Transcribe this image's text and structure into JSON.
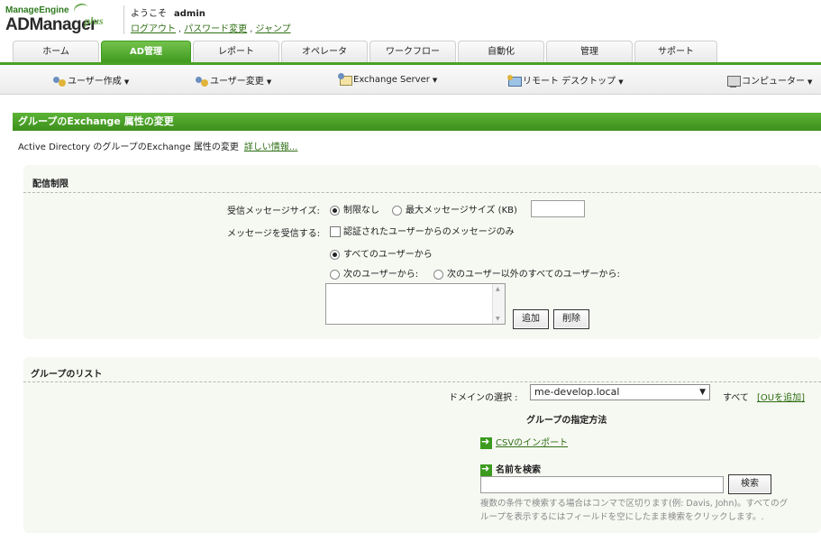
{
  "header": {
    "logo_top": "ManageEngine",
    "logo_main": "ADManager",
    "logo_plus": "plus",
    "welcome": "ようこそ",
    "user": "admin",
    "links": [
      "ログアウト",
      "パスワード変更",
      "ジャンプ"
    ],
    "sep": ","
  },
  "tabs": [
    "ホーム",
    "AD管理",
    "レポート",
    "オペレータ",
    "ワークフロー",
    "自動化",
    "管理",
    "サポート"
  ],
  "subnav": [
    "ユーザー作成",
    "ユーザー変更",
    "Exchange Server",
    "リモート デスクトップ",
    "コンピューター"
  ],
  "caret": "▼",
  "section": {
    "title": "グループのExchange 属性の変更",
    "description": "Active Directory のグループのExchange 属性の変更",
    "more_link": "詳しい情報..."
  },
  "delivery": {
    "title": "配信制限",
    "msg_size_label": "受信メッセージサイズ:",
    "opt_unlimited": "制限なし",
    "opt_max": "最大メッセージサイズ (KB)",
    "max_size_value": "",
    "accept_label": "メッセージを受信する:",
    "auth_only": "認証されたユーザーからのメッセージのみ",
    "from_all": "すべてのユーザーから",
    "from_following": "次のユーザーから:",
    "from_all_except": "次のユーザー以外のすべてのユーザーから:",
    "add_button": "追加",
    "delete_button": "削除"
  },
  "groups": {
    "title": "グループのリスト",
    "domain_label": "ドメインの選択 :",
    "domain_value": "me-develop.local",
    "all_label": "すべて",
    "add_ou": "[OUを追加]",
    "method_title": "グループの指定方法",
    "csv_import": "CSVのインポート",
    "search_by_name": "名前を検索",
    "search_value": "",
    "search_button": "検索",
    "hint_line1": "複数の条件で検索する場合はコンマで区切ります(例: Davis, John)。すべてのグ",
    "hint_line2": "ループを表示するにはフィールドを空にしたまま検索をクリックします。."
  },
  "colors": {
    "accent": "#4aa127",
    "link": "#2f6f14",
    "panel_bg": "#f6f8f2"
  }
}
